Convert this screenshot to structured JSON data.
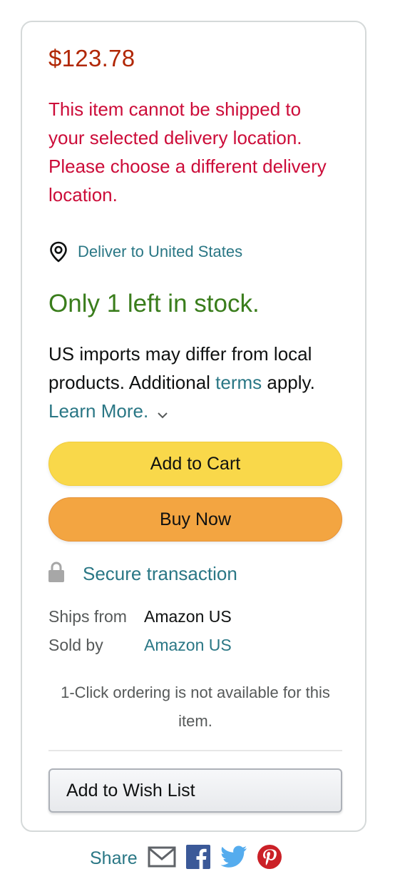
{
  "price": "$123.78",
  "shipping_error": "This item cannot be shipped to your selected delivery location. Please choose a different delivery location.",
  "deliver_to": "Deliver to United States",
  "stock": "Only 1 left in stock.",
  "imports": {
    "text_before": "US imports may differ from local products. Additional ",
    "terms_link": "terms",
    "text_after": " apply.",
    "learn_more": "Learn More."
  },
  "buttons": {
    "add_to_cart": "Add to Cart",
    "buy_now": "Buy Now",
    "add_to_wish_list": "Add to Wish List"
  },
  "secure_transaction": "Secure transaction",
  "ships_from": {
    "label": "Ships from",
    "value": "Amazon US"
  },
  "sold_by": {
    "label": "Sold by",
    "value": "Amazon US"
  },
  "one_click_note": "1-Click ordering is not available for this item.",
  "share": {
    "label": "Share",
    "icons": [
      "email-icon",
      "facebook-icon",
      "twitter-icon",
      "pinterest-icon"
    ]
  },
  "colors": {
    "price": "#b12704",
    "error": "#cc0c39",
    "link": "#2a7785",
    "stock": "#3a7d1c",
    "add_to_cart": "#f9d84a",
    "buy_now": "#f3a541"
  }
}
